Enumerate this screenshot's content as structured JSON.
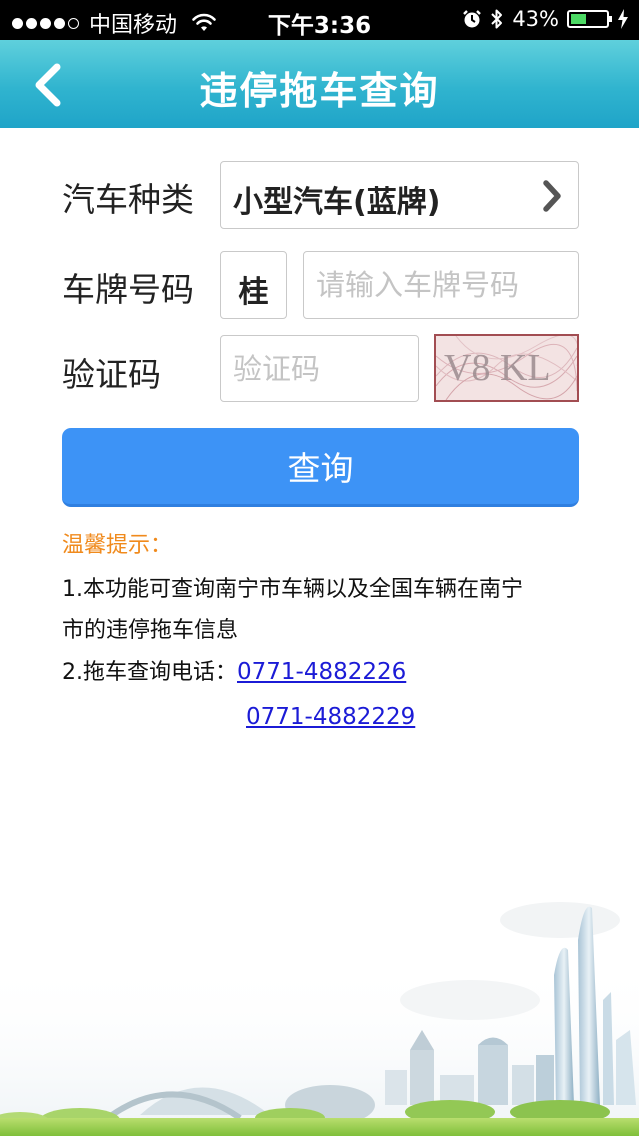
{
  "status_bar": {
    "carrier": "中国移动",
    "time": "下午3:36",
    "battery_percent": "43%",
    "battery_level": 0.43,
    "signal_bars_filled": 4,
    "signal_bars_total": 5
  },
  "nav": {
    "title": "违停拖车查询",
    "back_icon": "chevron-left-icon"
  },
  "form": {
    "vehicle_type_label": "汽车种类",
    "vehicle_type_value": "小型汽车(蓝牌)",
    "plate_label": "车牌号码",
    "plate_province": "桂",
    "plate_placeholder": "请输入车牌号码",
    "captcha_label": "验证码",
    "captcha_placeholder": "验证码",
    "captcha_text": "V8 KL",
    "query_button": "查询"
  },
  "tips": {
    "title": "温馨提示：",
    "line1a": "1.本功能可查询南宁市车辆以及全国车辆在南宁",
    "line1b": "市的违停拖车信息",
    "line2_prefix": "2.拖车查询电话：",
    "phone1": "0771-4882226",
    "phone2": "0771-4882229"
  },
  "colors": {
    "nav_gradient_top": "#5fd0dc",
    "nav_gradient_bottom": "#1fa4c8",
    "button_blue": "#3d93f6",
    "tips_orange": "#f08a1c",
    "link_blue": "#1b1bd6",
    "battery_green": "#4cd964"
  }
}
